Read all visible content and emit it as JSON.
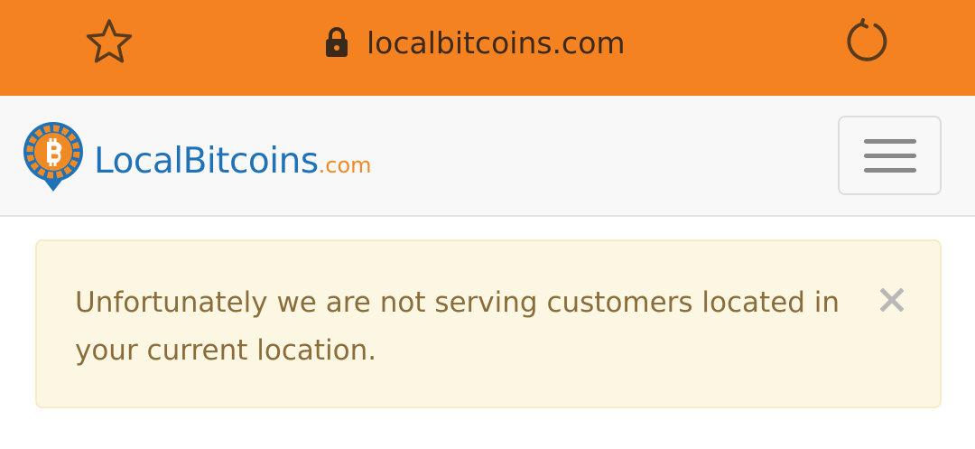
{
  "browser": {
    "url": "localbitcoins.com",
    "bar_color": "#f58220",
    "icons": {
      "bookmark": "star-icon",
      "secure": "lock-icon",
      "reload": "reload-icon"
    }
  },
  "header": {
    "brand_name": "LocalBitcoins",
    "brand_tld": ".com",
    "brand_color": "#1f72b8",
    "accent_color": "#f08a24",
    "menu_icon": "hamburger-icon"
  },
  "alert": {
    "message": "Unfortunately we are not serving customers located in your current location.",
    "close_icon": "close-icon",
    "text_color": "#8a6d3b",
    "background": "#fcf7e3"
  }
}
